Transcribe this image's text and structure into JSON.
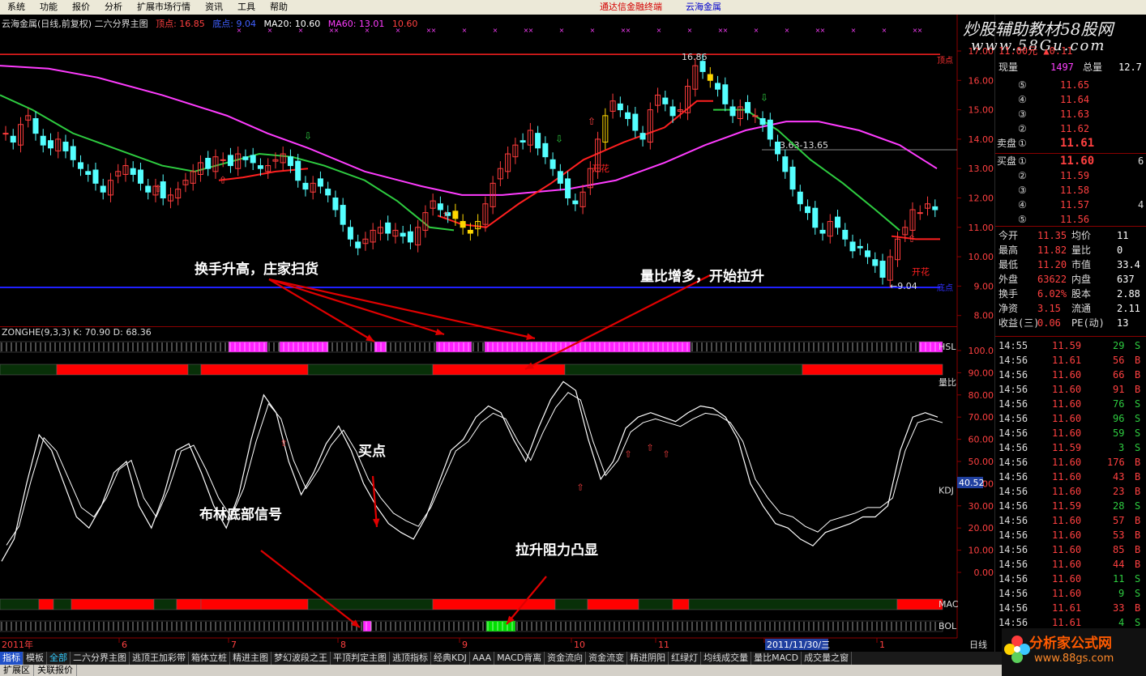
{
  "menu": {
    "items": [
      "系统",
      "功能",
      "报价",
      "分析",
      "扩展市场行情",
      "资讯",
      "工具",
      "帮助"
    ],
    "notice": "通达信金融终端",
    "stock_name": "云海金属"
  },
  "header": {
    "title": "云海金属(日线,前复权)  二六分界主图",
    "top_label": "顶点: 16.85",
    "bottom_label": "底点: 9.04",
    "ma20": "MA20: 10.60",
    "ma60": "MA60: 13.01",
    "extra": "10.60"
  },
  "price_axis": {
    "ticks": [
      "17.00",
      "16.00",
      "15.00",
      "14.00",
      "13.00",
      "12.00",
      "11.00",
      "10.00",
      "9.00",
      "8.00"
    ],
    "top_tag": "顶点",
    "bottom_tag": "底点"
  },
  "annotations": {
    "turnover": "换手升高，庄家扫货",
    "volume_ratio": "量比增多，开始拉升",
    "buy_point": "买点",
    "bollinger": "布林底部信号",
    "resistance": "拉升阻力凸显",
    "peak_label": "16.86",
    "trough_label": "9.04",
    "range_label": "13.63-13.65",
    "kaihua": "开花"
  },
  "indicator": {
    "zonghe_label": "ZONGHE(9,3,3)",
    "k_label": "K: 70.90",
    "d_label": "D: 68.36",
    "hsl": "HSL",
    "liangbi": "量比",
    "kdj": "KDJ",
    "mac": "MAC",
    "bol": "BOL",
    "kdj_ticks": [
      "100.0",
      "90.00",
      "80.00",
      "70.00",
      "60.00",
      "50.00",
      "40.00",
      "30.00",
      "20.00",
      "10.00",
      "0.00"
    ],
    "current": "40.52"
  },
  "time_axis": {
    "labels": [
      "2011年",
      "6",
      "7",
      "8",
      "9",
      "10",
      "11",
      "2011/11/30/三",
      "1"
    ],
    "period": "日线"
  },
  "quote": {
    "watermark_title": "炒股辅助教材58股网",
    "watermark_url": "www.58Gu.com",
    "top_partial": "11.00元  ▲0.11",
    "vol_label": "现量",
    "vol_value": "1497",
    "total_label": "总量",
    "total_value": "12.7",
    "sell": [
      {
        "idx": "⑤",
        "price": "11.65"
      },
      {
        "idx": "④",
        "price": "11.64"
      },
      {
        "idx": "③",
        "price": "11.63"
      },
      {
        "idx": "②",
        "price": "11.62"
      },
      {
        "idx": "①",
        "price": "11.61",
        "label": "卖盘"
      }
    ],
    "buy": [
      {
        "idx": "①",
        "price": "11.60",
        "label": "买盘",
        "vol": "6"
      },
      {
        "idx": "②",
        "price": "11.59"
      },
      {
        "idx": "③",
        "price": "11.58"
      },
      {
        "idx": "④",
        "price": "11.57",
        "vol": "4"
      },
      {
        "idx": "⑤",
        "price": "11.56"
      }
    ],
    "stats": [
      [
        "今开",
        "11.35",
        "均价",
        "11"
      ],
      [
        "最高",
        "11.82",
        "量比",
        "0"
      ],
      [
        "最低",
        "11.20",
        "市值",
        "33.4"
      ],
      [
        "外盘",
        "63622",
        "内盘",
        "637"
      ],
      [
        "换手",
        "6.02%",
        "股本",
        "2.88"
      ],
      [
        "净资",
        "3.15",
        "流通",
        "2.11"
      ],
      [
        "收益(三)",
        "0.06",
        "PE(动)",
        "13"
      ]
    ],
    "ticks": [
      [
        "14:55",
        "11.59",
        "29",
        "S"
      ],
      [
        "14:56",
        "11.61",
        "56",
        "B"
      ],
      [
        "14:56",
        "11.60",
        "66",
        "B"
      ],
      [
        "14:56",
        "11.60",
        "91",
        "B"
      ],
      [
        "14:56",
        "11.60",
        "76",
        "S"
      ],
      [
        "14:56",
        "11.60",
        "96",
        "S"
      ],
      [
        "14:56",
        "11.60",
        "59",
        "S"
      ],
      [
        "14:56",
        "11.59",
        "3",
        "S"
      ],
      [
        "14:56",
        "11.60",
        "176",
        "B"
      ],
      [
        "14:56",
        "11.60",
        "43",
        "B"
      ],
      [
        "14:56",
        "11.60",
        "23",
        "B"
      ],
      [
        "14:56",
        "11.59",
        "28",
        "S"
      ],
      [
        "14:56",
        "11.60",
        "57",
        "B"
      ],
      [
        "14:56",
        "11.60",
        "53",
        "B"
      ],
      [
        "14:56",
        "11.60",
        "85",
        "B"
      ],
      [
        "14:56",
        "11.60",
        "44",
        "B"
      ],
      [
        "14:56",
        "11.60",
        "11",
        "S"
      ],
      [
        "14:56",
        "11.60",
        "9",
        "S"
      ],
      [
        "14:56",
        "11.61",
        "33",
        "B"
      ],
      [
        "14:56",
        "11.61",
        "4",
        "S"
      ]
    ]
  },
  "tabs": [
    "指标",
    "模板",
    "全部",
    "二六分界主图",
    "逃顶王加彩带",
    "箱体立桩",
    "精进主图",
    "梦幻波段之王",
    "平顶判定主图",
    "逃顶指标",
    "经典KDJ",
    "AAA",
    "MACD背离",
    "资金流向",
    "资金流变",
    "精进阴阳",
    "红绿灯",
    "均线成交量",
    "量比MACD",
    "成交量之窗"
  ],
  "tabs2": [
    "扩展区",
    "关联报价"
  ],
  "logo": {
    "name": "分析家公式网",
    "url": "www.88gs.com"
  },
  "colors": {
    "up": "#ff3c3c",
    "down": "#54ffff",
    "ma20": "#ff2020",
    "ma60": "#ff3cff",
    "ma_green": "#2ecc40",
    "magenta": "#ff20ff",
    "red": "#ff0000",
    "green": "#00cc00"
  }
}
